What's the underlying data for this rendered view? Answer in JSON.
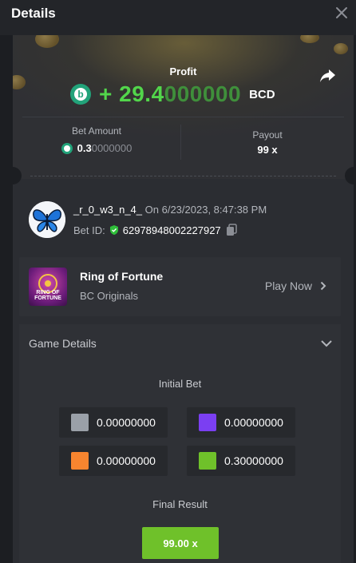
{
  "header": {
    "title": "Details"
  },
  "colors": {
    "profit_green": "#52d64b",
    "bcd_green": "#22a37a",
    "final_green": "#6fc12a"
  },
  "hero": {
    "profit_label": "Profit",
    "profit_sign": "+",
    "profit_amount_bright": "29.4",
    "profit_amount_dim": "000000",
    "currency": "BCD"
  },
  "stats": {
    "bet_amount_label": "Bet Amount",
    "bet_amount_bright": "0.3",
    "bet_amount_dim": "0000000",
    "payout_label": "Payout",
    "payout_value": "99 x"
  },
  "user": {
    "name": "_r_0_w3_n_4_",
    "date": "On 6/23/2023, 8:47:38 PM",
    "bet_id_label": "Bet ID:",
    "bet_id": "62978948002227927"
  },
  "game": {
    "thumb_text": "RING OF FORTUNE",
    "title": "Ring of Fortune",
    "provider": "BC Originals",
    "play_label": "Play Now"
  },
  "details": {
    "title": "Game Details",
    "initial_bet_label": "Initial Bet",
    "bets": [
      {
        "color": "#9aa0a8",
        "value": "0.00000000"
      },
      {
        "color": "#7b3ff2",
        "value": "0.00000000"
      },
      {
        "color": "#f7852f",
        "value": "0.00000000"
      },
      {
        "color": "#6fc12a",
        "value": "0.30000000"
      }
    ],
    "final_result_label": "Final Result",
    "final_result_value": "99.00 x"
  },
  "icons": [
    "close-icon",
    "share-icon",
    "bcd-coin-icon",
    "verified-shield-icon",
    "copy-icon",
    "chevron-right-icon",
    "chevron-down-icon"
  ]
}
